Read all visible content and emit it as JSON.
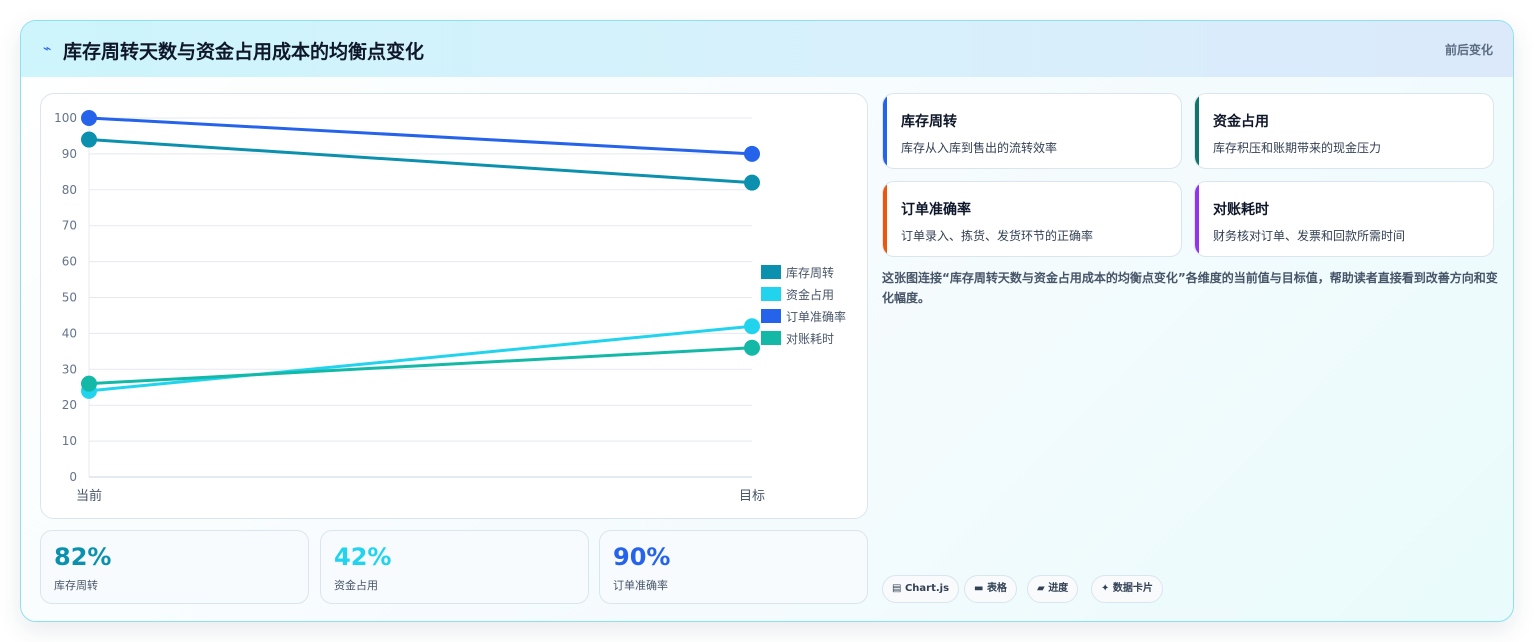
{
  "header": {
    "icon": "⌁",
    "title": "库存周转天数与资金占用成本的均衡点变化",
    "right_label": "前后变化"
  },
  "colors": {
    "series1": "#0b90ad",
    "series2": "#22d3ee",
    "series3": "#2563eb",
    "series4": "#14b8a6"
  },
  "chart_data": {
    "type": "line",
    "categories": [
      "当前",
      "目标"
    ],
    "ylim": [
      0,
      100
    ],
    "yticks": [
      0,
      10,
      20,
      30,
      40,
      50,
      60,
      70,
      80,
      90,
      100
    ],
    "grid": true,
    "legend_position": "right",
    "series": [
      {
        "name": "库存周转",
        "values": [
          94,
          82
        ],
        "color": "#0b90ad"
      },
      {
        "name": "资金占用",
        "values": [
          24,
          42
        ],
        "color": "#22d3ee"
      },
      {
        "name": "订单准确率",
        "values": [
          100,
          90
        ],
        "color": "#2563eb"
      },
      {
        "name": "对账耗时",
        "values": [
          26,
          36
        ],
        "color": "#14b8a6"
      }
    ]
  },
  "stats": [
    {
      "value": "82%",
      "label": "库存周转",
      "color": "#0b90ad"
    },
    {
      "value": "42%",
      "label": "资金占用",
      "color": "#22d3ee"
    },
    {
      "value": "90%",
      "label": "订单准确率",
      "color": "#2563eb"
    }
  ],
  "dimensions": [
    {
      "title": "库存周转",
      "desc": "库存从入库到售出的流转效率",
      "color": "#2563eb"
    },
    {
      "title": "资金占用",
      "desc": "库存积压和账期带来的现金压力",
      "color": "#0f766e"
    },
    {
      "title": "订单准确率",
      "desc": "订单录入、拣货、发货环节的正确率",
      "color": "#ea580c"
    },
    {
      "title": "对账耗时",
      "desc": "财务核对订单、发票和回款所需时间",
      "color": "#9333ea"
    }
  ],
  "description": "这张图连接“库存周转天数与资金占用成本的均衡点变化”各维度的当前值与目标值，帮助读者直接看到改善方向和变化幅度。",
  "tags": [
    {
      "icon": "▤",
      "label": "Chart.js"
    },
    {
      "icon": "▬",
      "label": "表格"
    },
    {
      "icon": "▰",
      "label": "进度"
    },
    {
      "icon": "✦",
      "label": "数据卡片"
    }
  ]
}
